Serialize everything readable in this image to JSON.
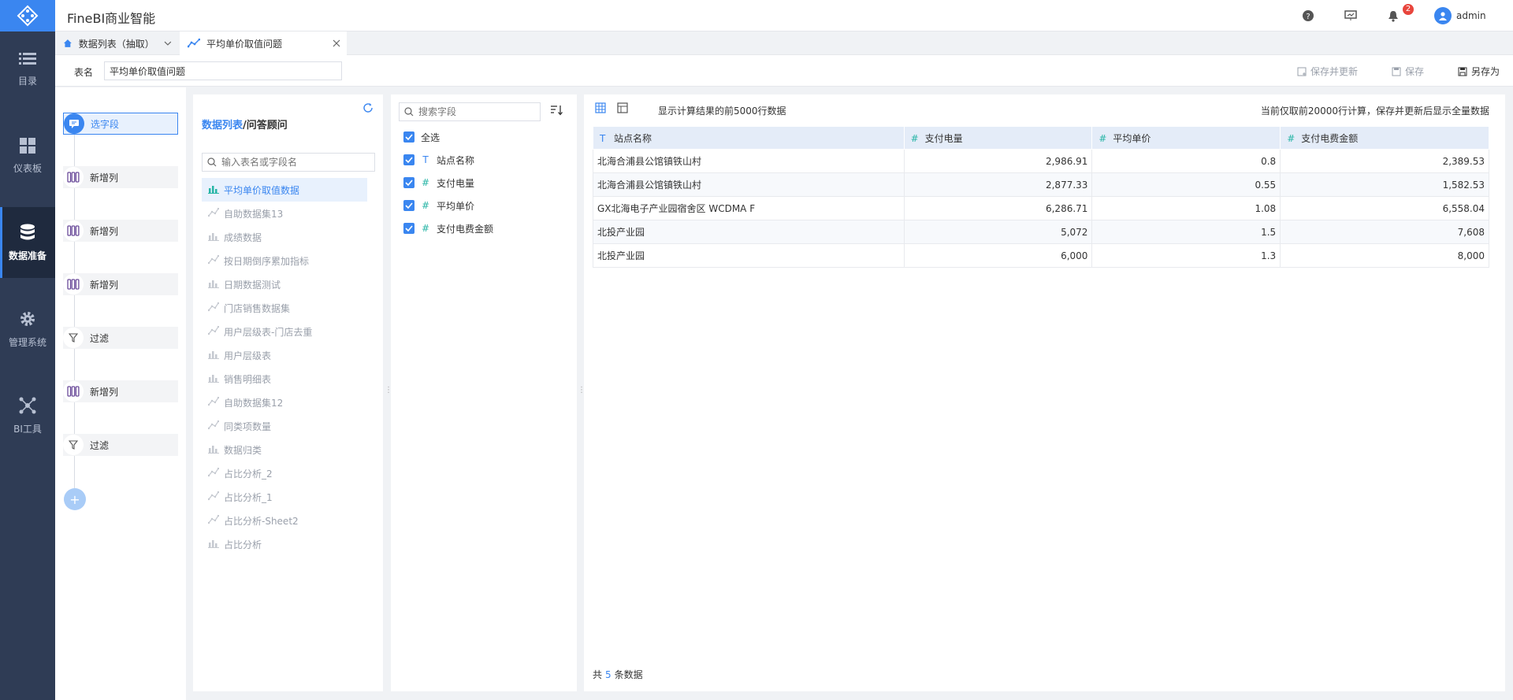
{
  "app": {
    "title": "FineBI商业智能",
    "notification_count": "2",
    "user": "admin"
  },
  "nav": [
    {
      "label": "目录",
      "icon": "list-icon"
    },
    {
      "label": "仪表板",
      "icon": "dashboard-icon"
    },
    {
      "label": "数据准备",
      "icon": "database-icon",
      "active": true
    },
    {
      "label": "管理系统",
      "icon": "gear-icon"
    },
    {
      "label": "BI工具",
      "icon": "network-icon"
    }
  ],
  "tabs": [
    {
      "label": "数据列表（抽取）"
    },
    {
      "label": "平均单价取值问题",
      "active": true
    }
  ],
  "namebar": {
    "label": "表名",
    "value": "平均单价取值问题",
    "save_update": "保存并更新",
    "save": "保存",
    "save_as": "另存为"
  },
  "steps": [
    {
      "label": "选字段",
      "type": "select",
      "active": true
    },
    {
      "label": "新增列",
      "type": "column"
    },
    {
      "label": "新增列",
      "type": "column"
    },
    {
      "label": "新增列",
      "type": "column"
    },
    {
      "label": "过滤",
      "type": "filter"
    },
    {
      "label": "新增列",
      "type": "column"
    },
    {
      "label": "过滤",
      "type": "filter"
    }
  ],
  "datasets": {
    "title_link": "数据列表",
    "title_rest": "/问答顾问",
    "search_placeholder": "输入表名或字段名",
    "items": [
      {
        "label": "平均单价取值数据",
        "kind": "table",
        "active": true
      },
      {
        "label": "自助数据集13",
        "kind": "self"
      },
      {
        "label": "成绩数据",
        "kind": "table"
      },
      {
        "label": "按日期倒序累加指标",
        "kind": "self"
      },
      {
        "label": "日期数据测试",
        "kind": "table"
      },
      {
        "label": "门店销售数据集",
        "kind": "self"
      },
      {
        "label": "用户层级表-门店去重",
        "kind": "self"
      },
      {
        "label": "用户层级表",
        "kind": "table"
      },
      {
        "label": "销售明细表",
        "kind": "table"
      },
      {
        "label": "自助数据集12",
        "kind": "self"
      },
      {
        "label": "同类项数量",
        "kind": "self"
      },
      {
        "label": "数据归类",
        "kind": "table"
      },
      {
        "label": "占比分析_2",
        "kind": "self"
      },
      {
        "label": "占比分析_1",
        "kind": "self"
      },
      {
        "label": "占比分析-Sheet2",
        "kind": "self"
      },
      {
        "label": "占比分析",
        "kind": "table"
      }
    ]
  },
  "fields": {
    "search_placeholder": "搜索字段",
    "select_all": "全选",
    "items": [
      {
        "label": "站点名称",
        "type": "T"
      },
      {
        "label": "支付电量",
        "type": "#"
      },
      {
        "label": "平均单价",
        "type": "#"
      },
      {
        "label": "支付电费金额",
        "type": "#"
      }
    ]
  },
  "preview": {
    "note": "显示计算结果的前5000行数据",
    "right_note": "当前仅取前20000行计算，保存并更新后显示全量数据",
    "columns": [
      {
        "label": "站点名称",
        "type": "T"
      },
      {
        "label": "支付电量",
        "type": "#"
      },
      {
        "label": "平均单价",
        "type": "#"
      },
      {
        "label": "支付电费金额",
        "type": "#"
      }
    ],
    "rows": [
      [
        "北海合浦县公馆镇铁山村",
        "2,986.91",
        "0.8",
        "2,389.53"
      ],
      [
        "北海合浦县公馆镇铁山村",
        "2,877.33",
        "0.55",
        "1,582.53"
      ],
      [
        "GX北海电子产业园宿舍区 WCDMA F",
        "6,286.71",
        "1.08",
        "6,558.04"
      ],
      [
        "北投产业园",
        "5,072",
        "1.5",
        "7,608"
      ],
      [
        "北投产业园",
        "6,000",
        "1.3",
        "8,000"
      ]
    ],
    "footer_prefix": "共",
    "footer_count": "5",
    "footer_suffix": "条数据"
  }
}
